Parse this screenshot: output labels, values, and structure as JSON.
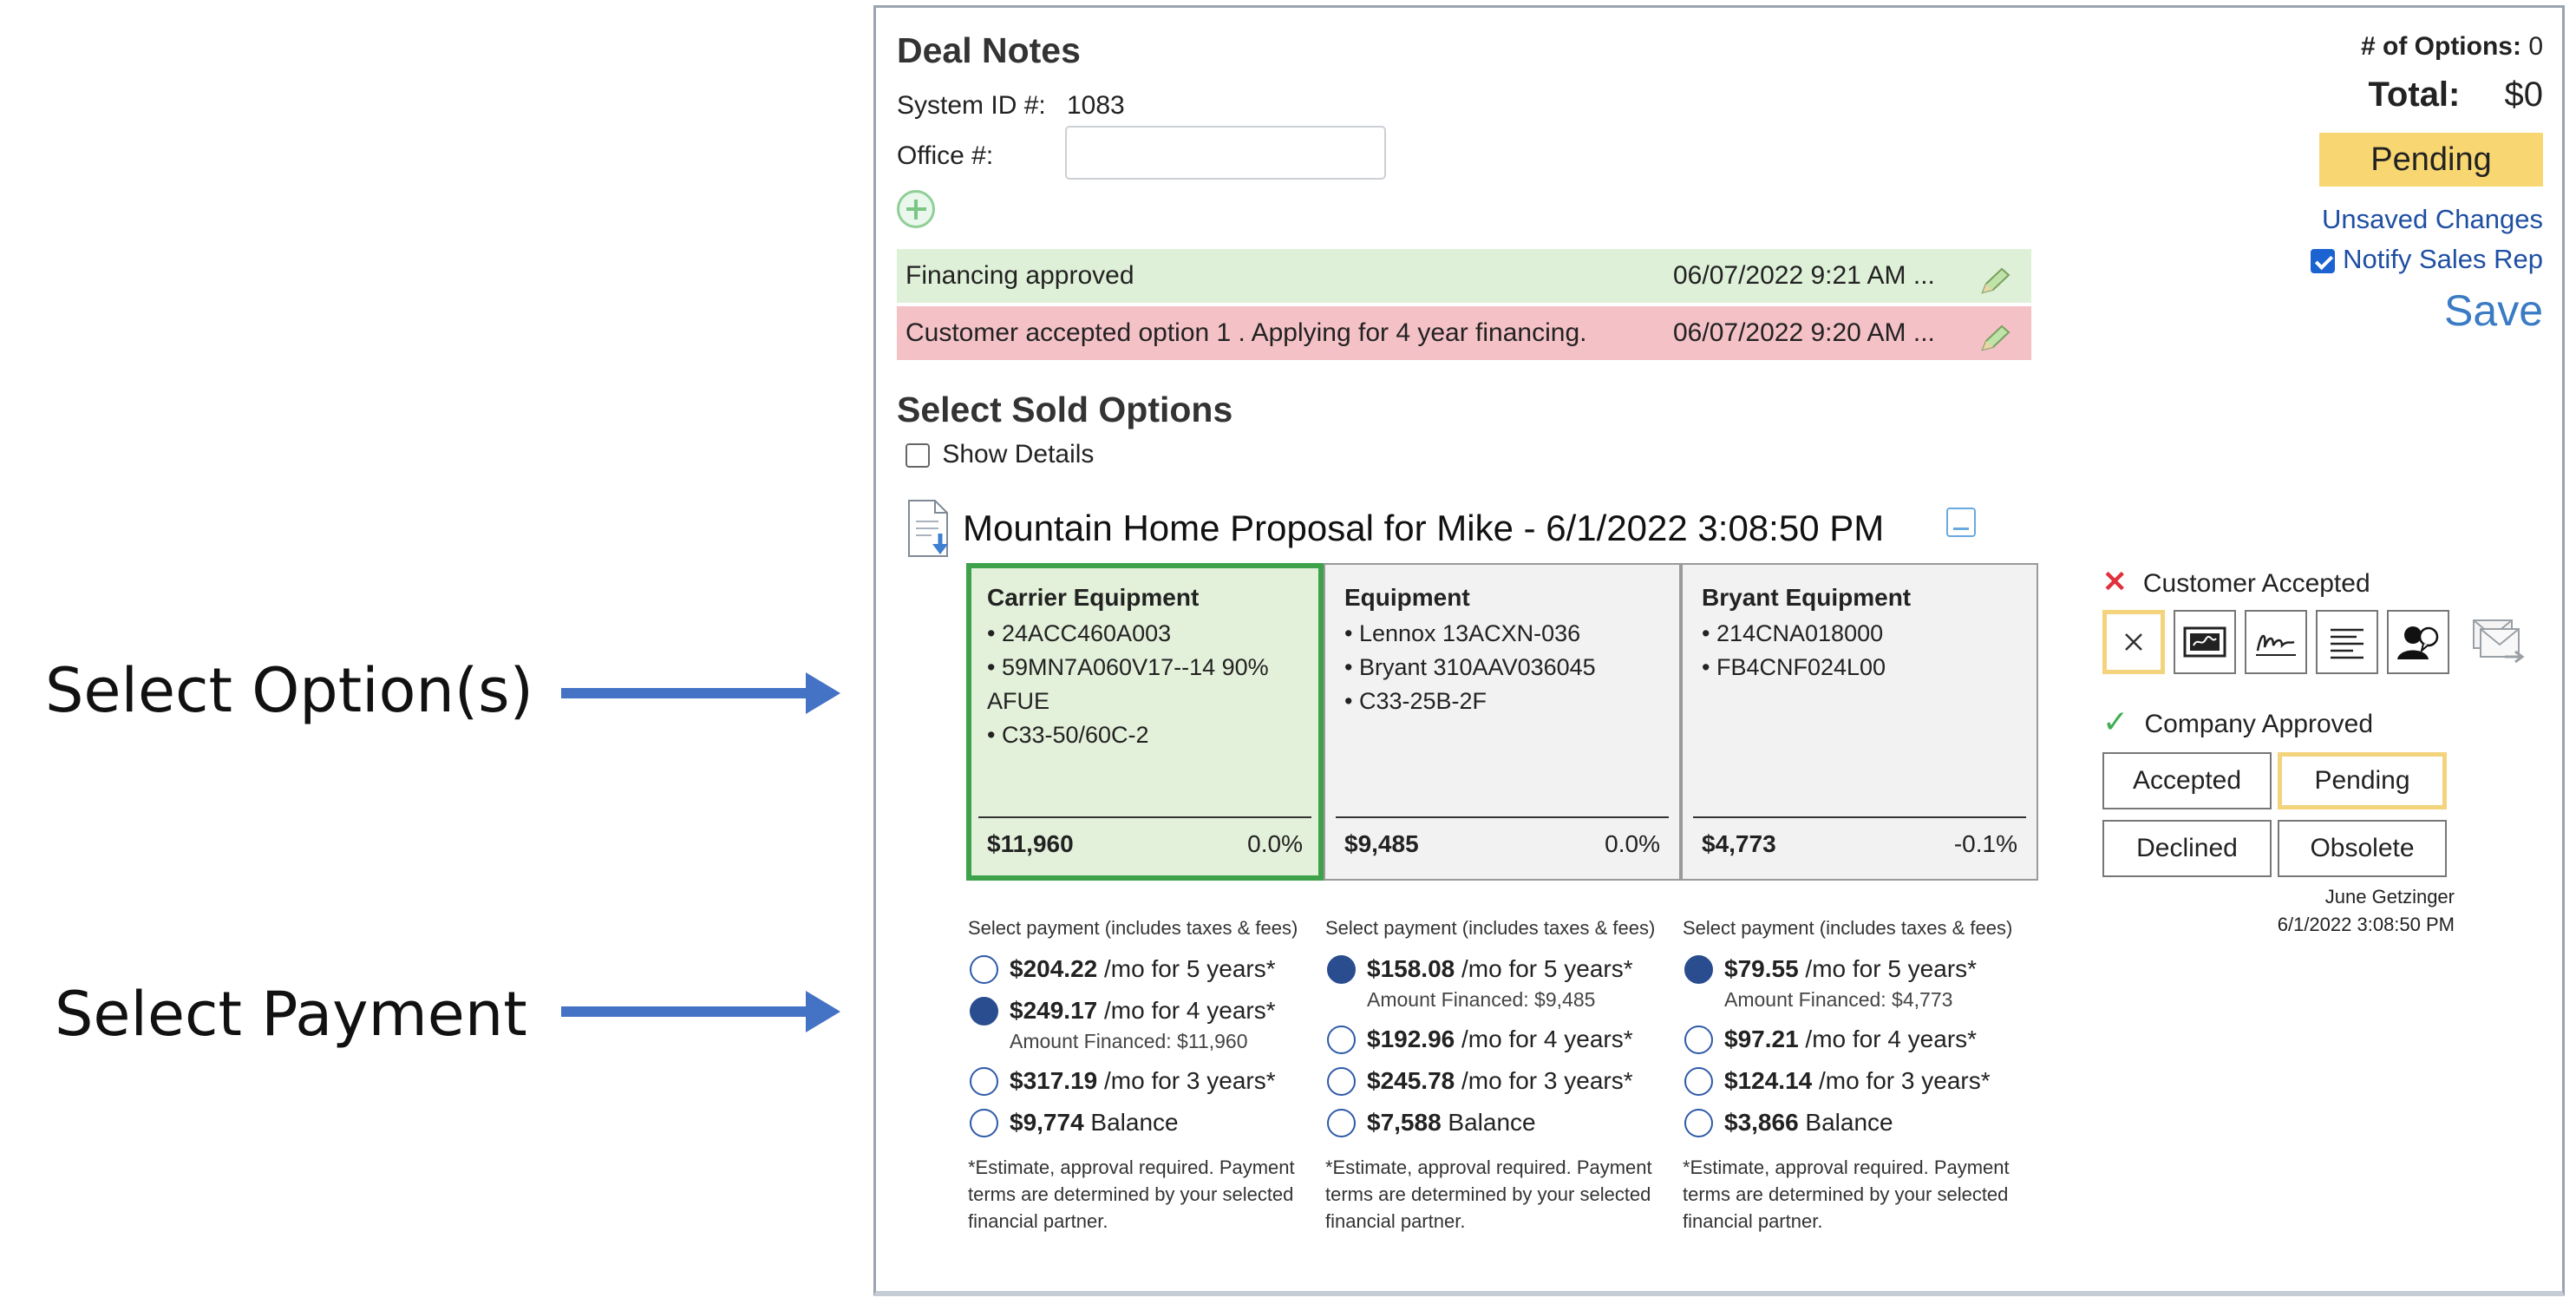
{
  "annotations": {
    "select_options": "Select Option(s)",
    "select_payment": "Select Payment"
  },
  "colors": {
    "accent_blue": "#4472c4",
    "selected_green": "#3da24a",
    "pending_yellow": "#f8d772",
    "financing_row": "#dff0d8",
    "accepted_row": "#f4c1c6",
    "link_blue": "#1f4fa3"
  },
  "deal": {
    "title": "Deal Notes",
    "system_id_label": "System ID #:",
    "system_id": "1083",
    "office_label": "Office #:",
    "office_value": "",
    "add_note_icon": "plus-circle-icon",
    "notes": [
      {
        "text": "Financing approved",
        "timestamp": "06/07/2022 9:21 AM ...",
        "status": "approved"
      },
      {
        "text": "Customer accepted option 1 . Applying for 4 year financing.",
        "timestamp": "06/07/2022 9:20 AM ...",
        "status": "accepted"
      }
    ]
  },
  "summary": {
    "options_label": "# of Options:",
    "options_count": "0",
    "total_label": "Total:",
    "total_value": "$0",
    "status": "Pending",
    "unsaved": "Unsaved Changes",
    "notify_label": "Notify Sales Rep",
    "notify_checked": true,
    "save": "Save"
  },
  "sold": {
    "title": "Select Sold Options",
    "show_details": "Show Details",
    "show_details_checked": false
  },
  "proposal": {
    "title": "Mountain Home Proposal for Mike - 6/1/2022 3:08:50 PM",
    "options": [
      {
        "title": "Carrier Equipment",
        "items": [
          "24ACC460A003",
          "59MN7A060V17--14 90% AFUE",
          "C33-50/60C-2"
        ],
        "price": "$11,960",
        "pct": "0.0%",
        "selected": true,
        "payment_header": "Select payment (includes taxes & fees)",
        "payments": [
          {
            "amount": "$204.22",
            "term": "/mo for 5 years*",
            "selected": false,
            "financed": ""
          },
          {
            "amount": "$249.17",
            "term": "/mo for 4 years*",
            "selected": true,
            "financed": "Amount Financed: $11,960"
          },
          {
            "amount": "$317.19",
            "term": "/mo for 3 years*",
            "selected": false,
            "financed": ""
          },
          {
            "amount": "$9,774",
            "term": "Balance",
            "selected": false,
            "financed": ""
          }
        ],
        "footnote": "*Estimate, approval required. Payment terms are determined by your selected financial partner."
      },
      {
        "title": "Equipment",
        "items": [
          "Lennox 13ACXN-036",
          "Bryant 310AAV036045",
          "C33-25B-2F"
        ],
        "price": "$9,485",
        "pct": "0.0%",
        "selected": false,
        "payment_header": "Select payment (includes taxes & fees)",
        "payments": [
          {
            "amount": "$158.08",
            "term": "/mo for 5 years*",
            "selected": true,
            "financed": "Amount Financed: $9,485"
          },
          {
            "amount": "$192.96",
            "term": "/mo for 4 years*",
            "selected": false,
            "financed": ""
          },
          {
            "amount": "$245.78",
            "term": "/mo for 3 years*",
            "selected": false,
            "financed": ""
          },
          {
            "amount": "$7,588",
            "term": "Balance",
            "selected": false,
            "financed": ""
          }
        ],
        "footnote": "*Estimate, approval required. Payment terms are determined by your selected financial partner."
      },
      {
        "title": "Bryant Equipment",
        "items": [
          "214CNA018000",
          "FB4CNF024L00"
        ],
        "price": "$4,773",
        "pct": "-0.1%",
        "selected": false,
        "payment_header": "Select payment (includes taxes & fees)",
        "payments": [
          {
            "amount": "$79.55",
            "term": "/mo for 5 years*",
            "selected": true,
            "financed": "Amount Financed: $4,773"
          },
          {
            "amount": "$97.21",
            "term": "/mo for 4 years*",
            "selected": false,
            "financed": ""
          },
          {
            "amount": "$124.14",
            "term": "/mo for 3 years*",
            "selected": false,
            "financed": ""
          },
          {
            "amount": "$3,866",
            "term": "Balance",
            "selected": false,
            "financed": ""
          }
        ],
        "footnote": "*Estimate, approval required. Payment terms are determined by your selected financial partner."
      }
    ]
  },
  "status_panel": {
    "customer_accepted": "Customer Accepted",
    "customer_accepted_icon": "x-mark-icon",
    "company_approved": "Company Approved",
    "company_approved_icon": "check-icon",
    "signature_tools": [
      "clear-icon",
      "signature-pad-icon",
      "signature-icon",
      "text-lines-icon",
      "person-chat-icon"
    ],
    "email_icon": "email-send-icon",
    "buttons": {
      "accepted": "Accepted",
      "pending": "Pending",
      "declined": "Declined",
      "obsolete": "Obsolete"
    },
    "user": "June Getzinger",
    "date": "6/1/2022 3:08:50 PM"
  }
}
